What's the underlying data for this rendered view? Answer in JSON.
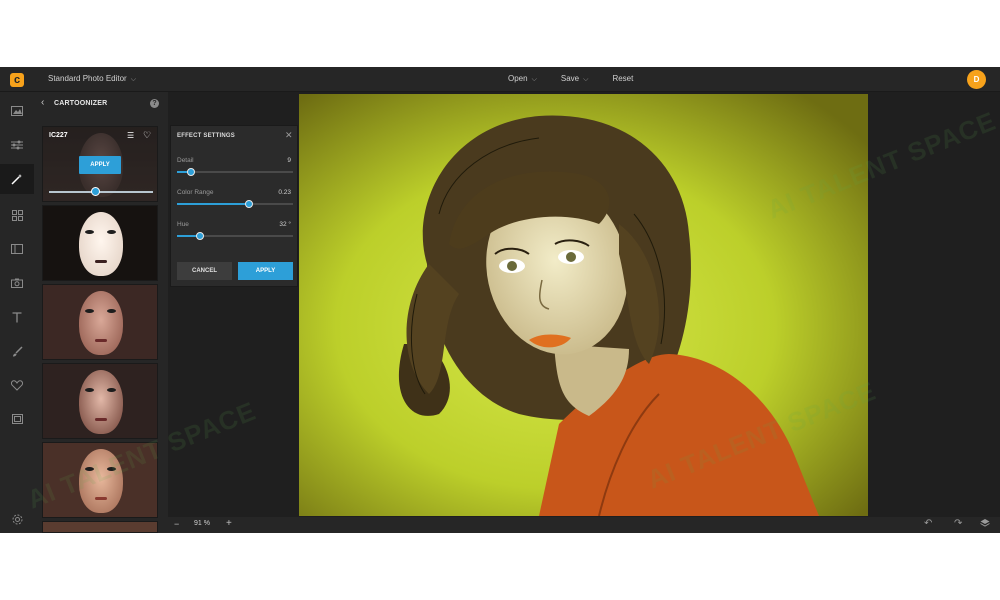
{
  "header": {
    "app_title": "Standard Photo Editor",
    "menu": [
      "Open",
      "Save",
      "Reset"
    ],
    "avatar_initial": "D"
  },
  "rail": {
    "icons": [
      "image-icon",
      "sliders-icon",
      "magic-wand-icon",
      "grid-icon",
      "layout-icon",
      "camera-icon",
      "text-icon",
      "brush-icon",
      "heart-icon",
      "frame-icon",
      "settings-icon"
    ],
    "active_index": 2
  },
  "panel": {
    "title": "CARTOONIZER",
    "selected_effect": {
      "label": "IC227",
      "apply_label": "APPLY",
      "intensity_fraction": 0.45
    }
  },
  "effect_settings": {
    "title": "EFFECT SETTINGS",
    "sliders": [
      {
        "label": "Detail",
        "value": "9",
        "fraction": 0.12
      },
      {
        "label": "Color Range",
        "value": "0.23",
        "fraction": 0.62
      },
      {
        "label": "Hue",
        "value": "32 °",
        "fraction": 0.2
      }
    ],
    "cancel_label": "CANCEL",
    "apply_label": "APPLY"
  },
  "canvas": {
    "zoom": "91 %"
  },
  "watermark": {
    "text": "AI TALENT SPACE"
  },
  "colors": {
    "accent": "#2d9fd8",
    "brand": "#f7a21b",
    "background": "#1f1f1f"
  }
}
